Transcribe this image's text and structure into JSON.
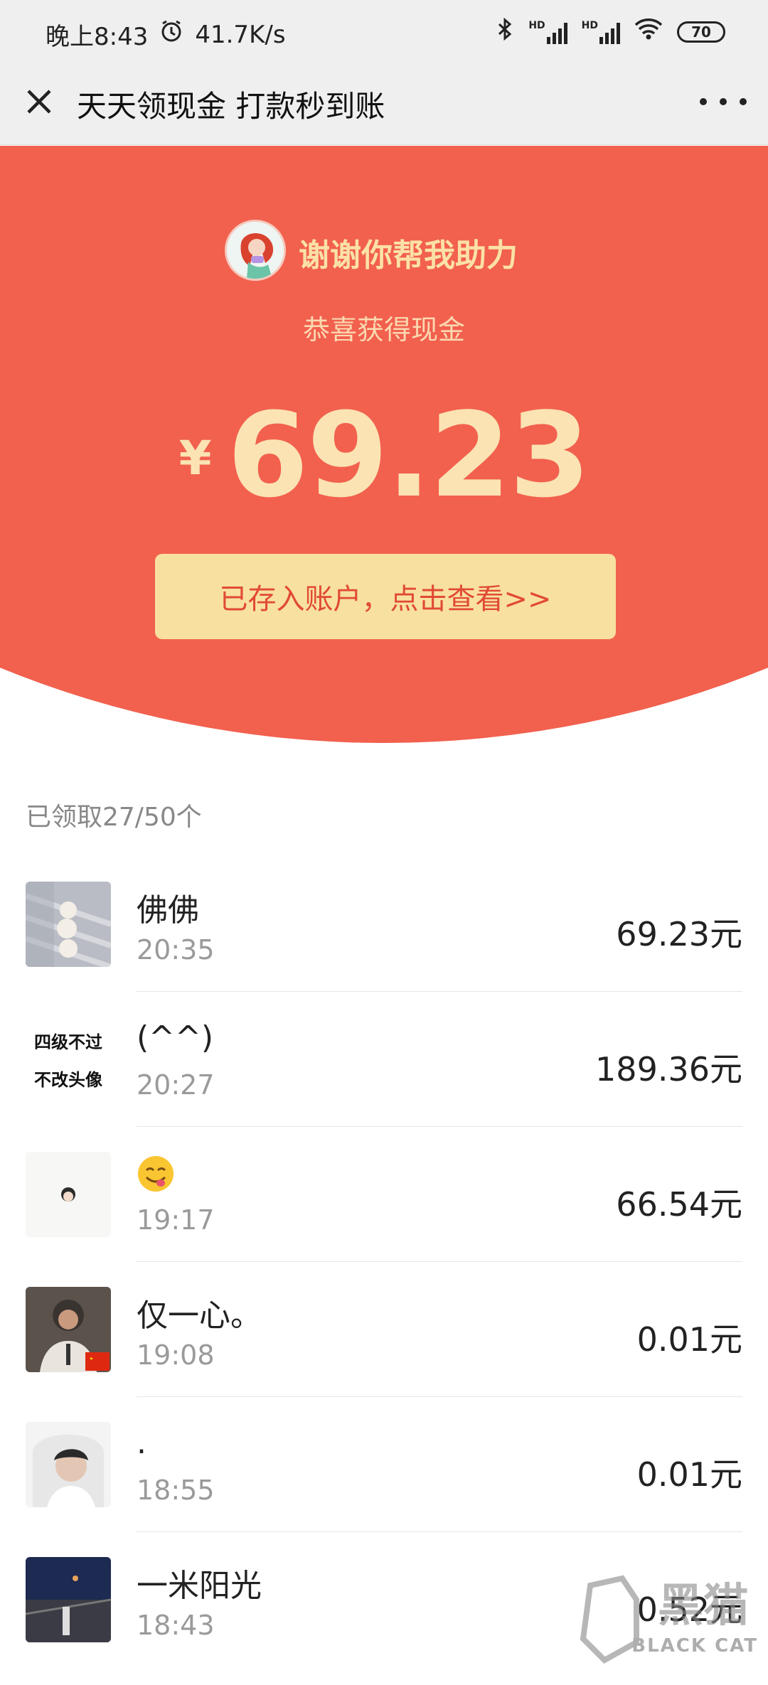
{
  "status_bar": {
    "time": "晚上8:43",
    "net_speed": "41.7K/s",
    "battery": "70",
    "hd1": "HD",
    "hd2": "HD"
  },
  "nav": {
    "title": "天天领现金 打款秒到账",
    "close_icon": "close-icon",
    "more_icon": "more-icon"
  },
  "hero": {
    "name": "谢谢你帮我助力",
    "subtitle": "恭喜获得现金",
    "currency": "¥",
    "amount": "69.23",
    "button": "已存入账户，点击查看>>"
  },
  "claimed_text": "已领取27/50个",
  "list": [
    {
      "name": "佛佛",
      "time": "20:35",
      "amount": "69.23元"
    },
    {
      "name": "(^^)",
      "time": "20:27",
      "amount": "189.36元",
      "avatar_text": [
        "四级不过",
        "不改头像"
      ]
    },
    {
      "name": "",
      "time": "19:17",
      "amount": "66.54元"
    },
    {
      "name": "仅一心。",
      "time": "19:08",
      "amount": "0.01元"
    },
    {
      "name": ".",
      "time": "18:55",
      "amount": "0.01元"
    },
    {
      "name": "一米阳光",
      "time": "18:43",
      "amount": "0.52元"
    }
  ],
  "watermark": {
    "text": "BLACK CAT",
    "logo_text": "黑猫"
  },
  "colors": {
    "hero_red": "#f2604e",
    "gold": "#fbe3b3",
    "button_bg": "#f8e0a0",
    "button_text": "#e14a35"
  }
}
